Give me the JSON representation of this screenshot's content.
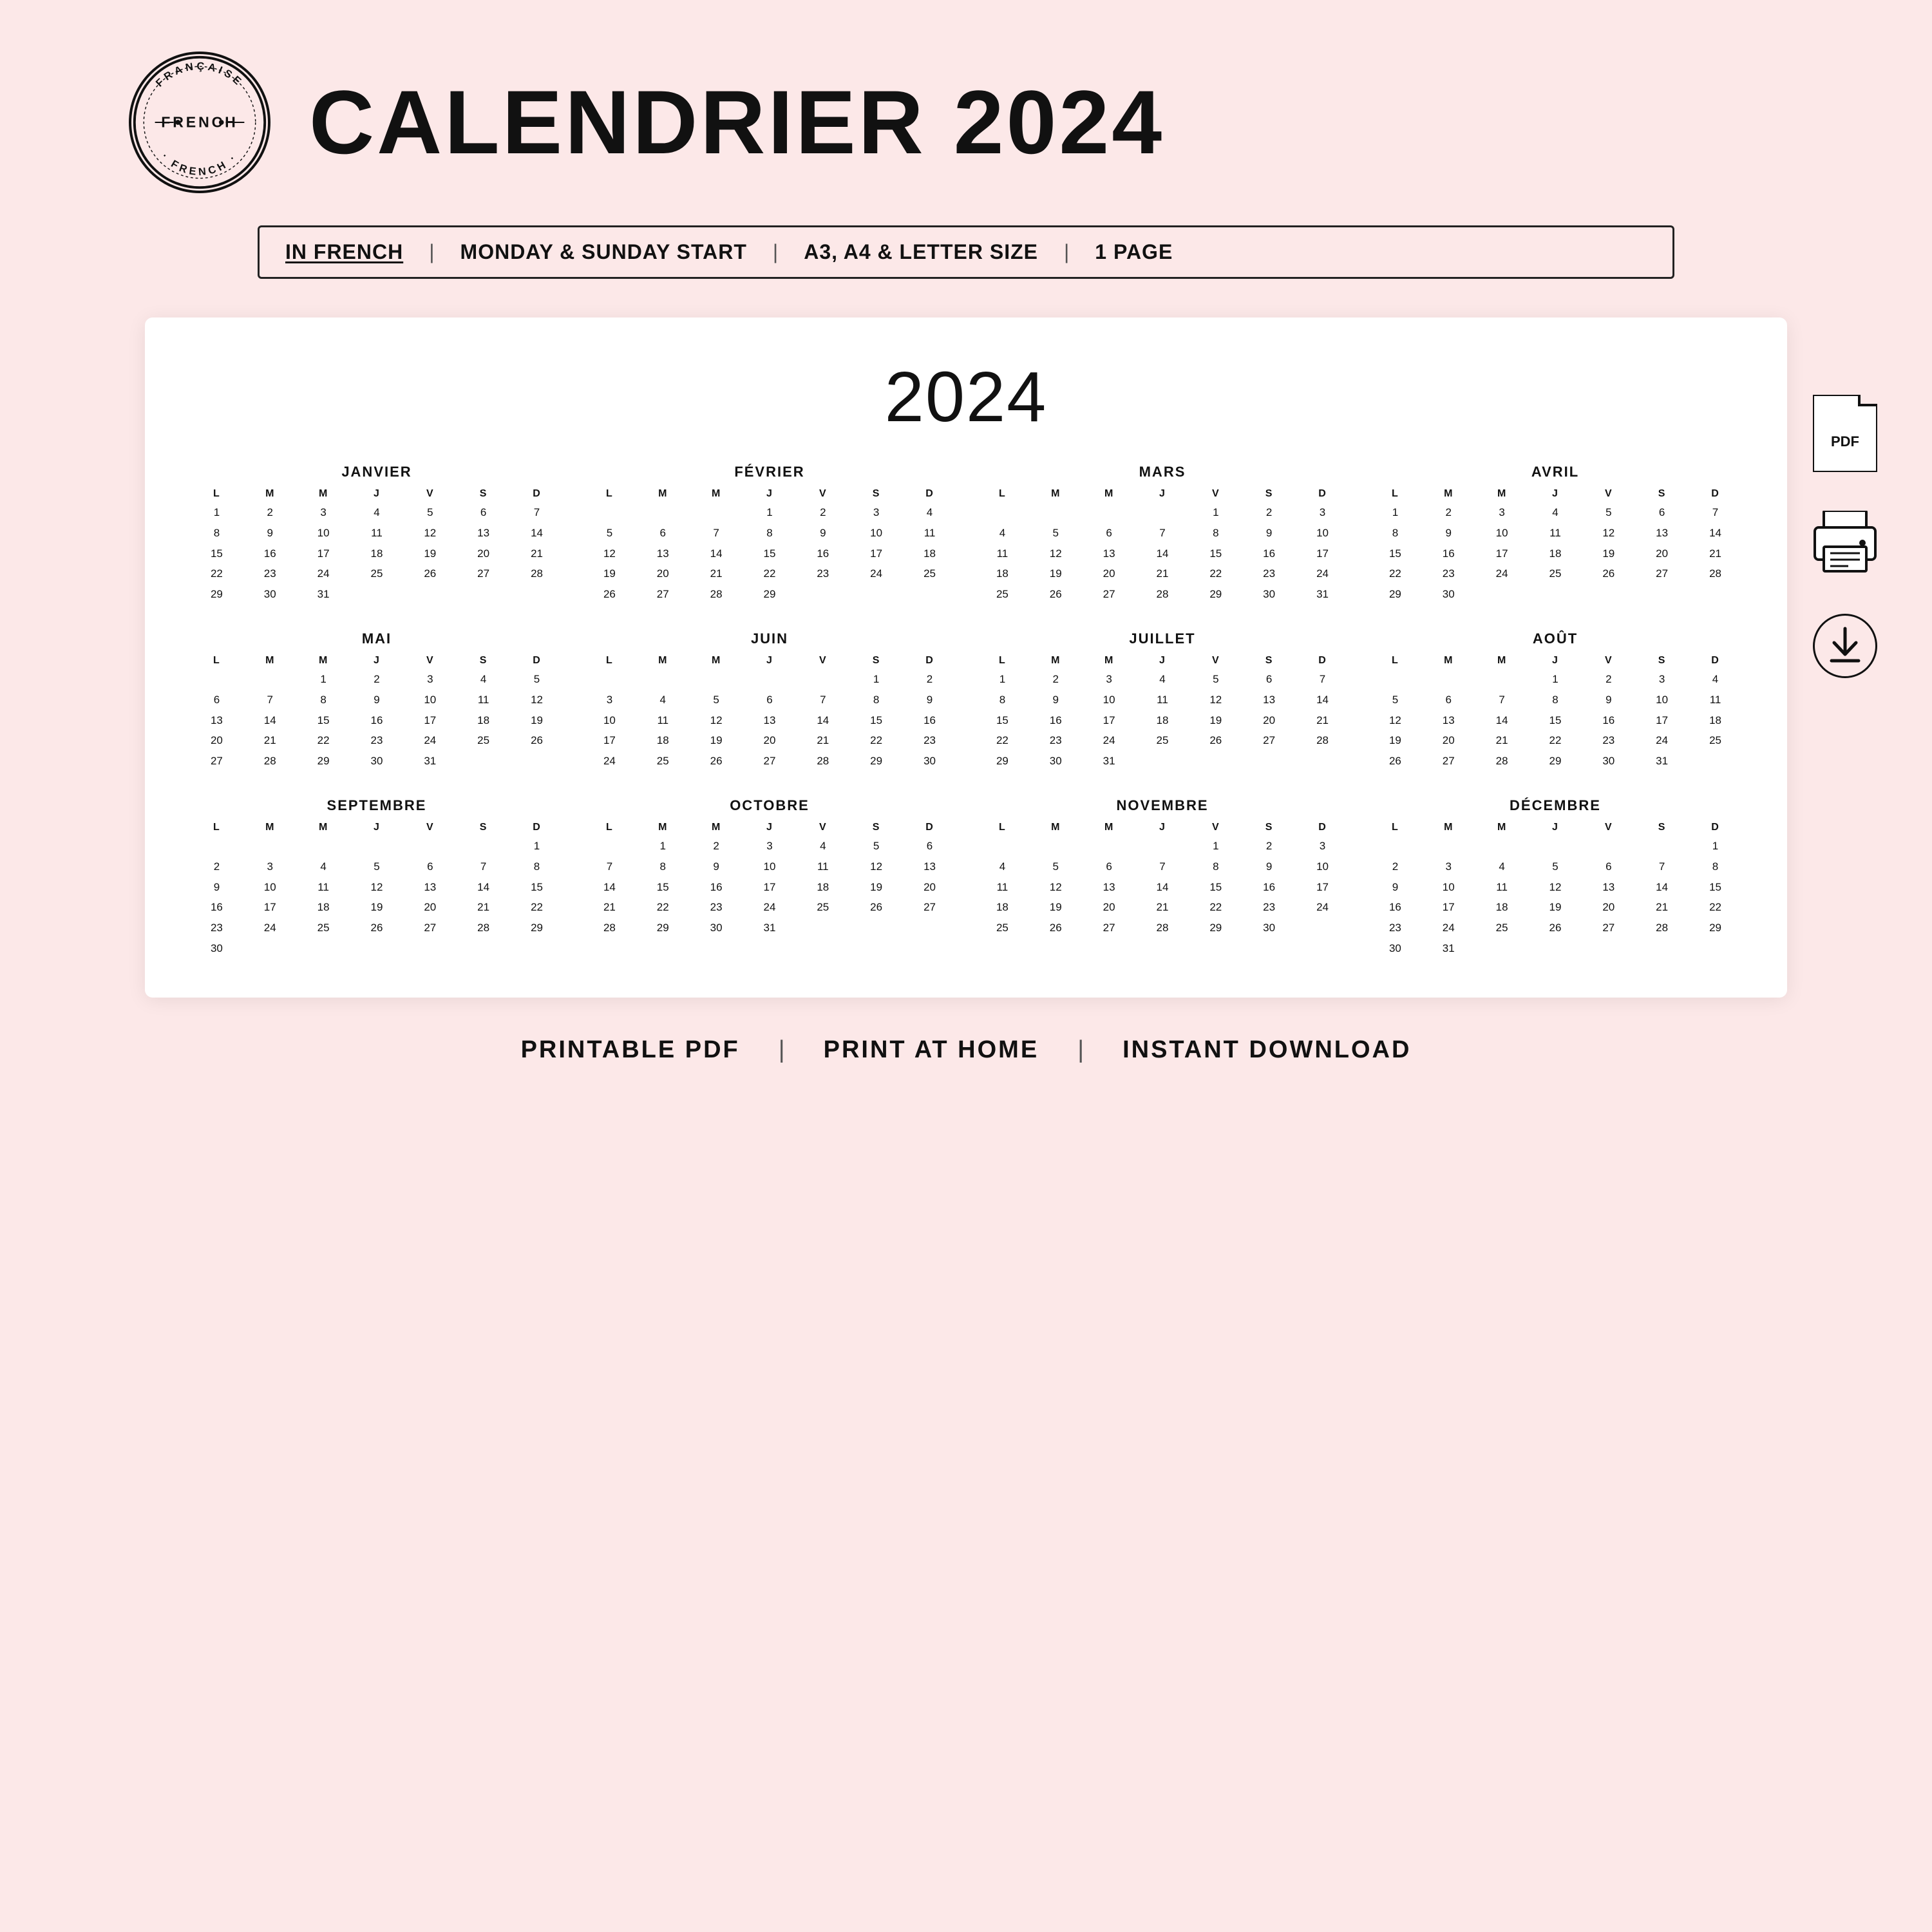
{
  "header": {
    "stamp": {
      "top": "FRANÇAISE",
      "middle": "FRENCH",
      "bottom": "·FRENCH·"
    },
    "title": "CALENDRIER 2024"
  },
  "infoBar": {
    "items": [
      "IN FRENCH",
      "MONDAY & SUNDAY START",
      "A3, A4 & LETTER SIZE",
      "1 PAGE"
    ]
  },
  "calendar": {
    "year": "2024",
    "dayHeaders": [
      "L",
      "M",
      "M",
      "J",
      "V",
      "S",
      "D"
    ],
    "months": [
      {
        "name": "JANVIER",
        "weeks": [
          [
            "1",
            "2",
            "3",
            "4",
            "5",
            "6",
            "7"
          ],
          [
            "8",
            "9",
            "10",
            "11",
            "12",
            "13",
            "14"
          ],
          [
            "15",
            "16",
            "17",
            "18",
            "19",
            "20",
            "21"
          ],
          [
            "22",
            "23",
            "24",
            "25",
            "26",
            "27",
            "28"
          ],
          [
            "29",
            "30",
            "31",
            "",
            "",
            "",
            ""
          ]
        ]
      },
      {
        "name": "FÉVRIER",
        "weeks": [
          [
            "",
            "",
            "",
            "1",
            "2",
            "3",
            "4"
          ],
          [
            "5",
            "6",
            "7",
            "8",
            "9",
            "10",
            "11"
          ],
          [
            "12",
            "13",
            "14",
            "15",
            "16",
            "17",
            "18"
          ],
          [
            "19",
            "20",
            "21",
            "22",
            "23",
            "24",
            "25"
          ],
          [
            "26",
            "27",
            "28",
            "29",
            "",
            "",
            ""
          ]
        ]
      },
      {
        "name": "MARS",
        "weeks": [
          [
            "",
            "",
            "",
            "",
            "1",
            "2",
            "3"
          ],
          [
            "4",
            "5",
            "6",
            "7",
            "8",
            "9",
            "10"
          ],
          [
            "11",
            "12",
            "13",
            "14",
            "15",
            "16",
            "17"
          ],
          [
            "18",
            "19",
            "20",
            "21",
            "22",
            "23",
            "24"
          ],
          [
            "25",
            "26",
            "27",
            "28",
            "29",
            "30",
            "31"
          ]
        ]
      },
      {
        "name": "AVRIL",
        "weeks": [
          [
            "1",
            "2",
            "3",
            "4",
            "5",
            "6",
            "7"
          ],
          [
            "8",
            "9",
            "10",
            "11",
            "12",
            "13",
            "14"
          ],
          [
            "15",
            "16",
            "17",
            "18",
            "19",
            "20",
            "21"
          ],
          [
            "22",
            "23",
            "24",
            "25",
            "26",
            "27",
            "28"
          ],
          [
            "29",
            "30",
            "",
            "",
            "",
            "",
            ""
          ]
        ]
      },
      {
        "name": "MAI",
        "weeks": [
          [
            "",
            "",
            "1",
            "2",
            "3",
            "4",
            "5"
          ],
          [
            "6",
            "7",
            "8",
            "9",
            "10",
            "11",
            "12"
          ],
          [
            "13",
            "14",
            "15",
            "16",
            "17",
            "18",
            "19"
          ],
          [
            "20",
            "21",
            "22",
            "23",
            "24",
            "25",
            "26"
          ],
          [
            "27",
            "28",
            "29",
            "30",
            "31",
            "",
            ""
          ]
        ]
      },
      {
        "name": "JUIN",
        "weeks": [
          [
            "",
            "",
            "",
            "",
            "",
            "1",
            "2"
          ],
          [
            "3",
            "4",
            "5",
            "6",
            "7",
            "8",
            "9"
          ],
          [
            "10",
            "11",
            "12",
            "13",
            "14",
            "15",
            "16"
          ],
          [
            "17",
            "18",
            "19",
            "20",
            "21",
            "22",
            "23"
          ],
          [
            "24",
            "25",
            "26",
            "27",
            "28",
            "29",
            "30"
          ]
        ]
      },
      {
        "name": "JUILLET",
        "weeks": [
          [
            "1",
            "2",
            "3",
            "4",
            "5",
            "6",
            "7"
          ],
          [
            "8",
            "9",
            "10",
            "11",
            "12",
            "13",
            "14"
          ],
          [
            "15",
            "16",
            "17",
            "18",
            "19",
            "20",
            "21"
          ],
          [
            "22",
            "23",
            "24",
            "25",
            "26",
            "27",
            "28"
          ],
          [
            "29",
            "30",
            "31",
            "",
            "",
            "",
            ""
          ]
        ]
      },
      {
        "name": "AOÛT",
        "weeks": [
          [
            "",
            "",
            "",
            "1",
            "2",
            "3",
            "4"
          ],
          [
            "5",
            "6",
            "7",
            "8",
            "9",
            "10",
            "11"
          ],
          [
            "12",
            "13",
            "14",
            "15",
            "16",
            "17",
            "18"
          ],
          [
            "19",
            "20",
            "21",
            "22",
            "23",
            "24",
            "25"
          ],
          [
            "26",
            "27",
            "28",
            "29",
            "30",
            "31",
            ""
          ]
        ]
      },
      {
        "name": "SEPTEMBRE",
        "weeks": [
          [
            "",
            "",
            "",
            "",
            "",
            "",
            "1"
          ],
          [
            "2",
            "3",
            "4",
            "5",
            "6",
            "7",
            "8"
          ],
          [
            "9",
            "10",
            "11",
            "12",
            "13",
            "14",
            "15"
          ],
          [
            "16",
            "17",
            "18",
            "19",
            "20",
            "21",
            "22"
          ],
          [
            "23",
            "24",
            "25",
            "26",
            "27",
            "28",
            "29"
          ],
          [
            "30",
            "",
            "",
            "",
            "",
            "",
            ""
          ]
        ]
      },
      {
        "name": "OCTOBRE",
        "weeks": [
          [
            "",
            "1",
            "2",
            "3",
            "4",
            "5",
            "6"
          ],
          [
            "7",
            "8",
            "9",
            "10",
            "11",
            "12",
            "13"
          ],
          [
            "14",
            "15",
            "16",
            "17",
            "18",
            "19",
            "20"
          ],
          [
            "21",
            "22",
            "23",
            "24",
            "25",
            "26",
            "27"
          ],
          [
            "28",
            "29",
            "30",
            "31",
            "",
            "",
            ""
          ]
        ]
      },
      {
        "name": "NOVEMBRE",
        "weeks": [
          [
            "",
            "",
            "",
            "",
            "1",
            "2",
            "3"
          ],
          [
            "4",
            "5",
            "6",
            "7",
            "8",
            "9",
            "10"
          ],
          [
            "11",
            "12",
            "13",
            "14",
            "15",
            "16",
            "17"
          ],
          [
            "18",
            "19",
            "20",
            "21",
            "22",
            "23",
            "24"
          ],
          [
            "25",
            "26",
            "27",
            "28",
            "29",
            "30",
            ""
          ]
        ]
      },
      {
        "name": "DÉCEMBRE",
        "weeks": [
          [
            "",
            "",
            "",
            "",
            "",
            "",
            "1"
          ],
          [
            "2",
            "3",
            "4",
            "5",
            "6",
            "7",
            "8"
          ],
          [
            "9",
            "10",
            "11",
            "12",
            "13",
            "14",
            "15"
          ],
          [
            "16",
            "17",
            "18",
            "19",
            "20",
            "21",
            "22"
          ],
          [
            "23",
            "24",
            "25",
            "26",
            "27",
            "28",
            "29"
          ],
          [
            "30",
            "31",
            "",
            "",
            "",
            "",
            ""
          ]
        ]
      }
    ]
  },
  "footer": {
    "items": [
      "PRINTABLE PDF",
      "PRINT AT HOME",
      "INSTANT DOWNLOAD"
    ]
  }
}
